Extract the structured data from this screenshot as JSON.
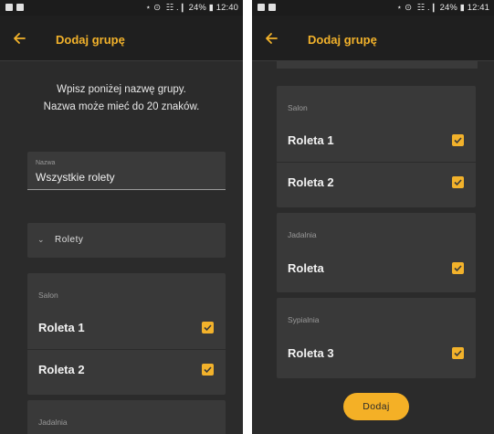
{
  "colors": {
    "accent": "#f2b22b",
    "background": "#2b2b2b",
    "card": "#393939"
  },
  "screen1": {
    "status": {
      "text": "⋆ ⊙  ☷ .❙ 24% ▮ 12:40"
    },
    "appbar": {
      "title": "Dodaj grupę",
      "back_icon": "arrow-left-icon"
    },
    "intro": {
      "line1": "Wpisz poniżej nazwę grupy.",
      "line2": "Nazwa może mieć do 20 znaków."
    },
    "name_field": {
      "label": "Nazwa",
      "value": "Wszystkie rolety"
    },
    "dropdown": {
      "label": "Rolety"
    },
    "groups": [
      {
        "room": "Salon",
        "items": [
          {
            "label": "Roleta 1",
            "checked": true
          },
          {
            "label": "Roleta 2",
            "checked": true
          }
        ]
      },
      {
        "room": "Jadalnia",
        "items": []
      }
    ]
  },
  "screen2": {
    "status": {
      "text": "⋆ ⊙  ☷ .❙ 24% ▮ 12:41"
    },
    "appbar": {
      "title": "Dodaj grupę",
      "back_icon": "arrow-left-icon"
    },
    "groups": [
      {
        "room": "Salon",
        "items": [
          {
            "label": "Roleta 1",
            "checked": true
          },
          {
            "label": "Roleta 2",
            "checked": true
          }
        ]
      },
      {
        "room": "Jadalnia",
        "items": [
          {
            "label": "Roleta",
            "checked": true
          }
        ]
      },
      {
        "room": "Sypialnia",
        "items": [
          {
            "label": "Roleta 3",
            "checked": true
          }
        ]
      }
    ],
    "add_button": "Dodaj"
  }
}
